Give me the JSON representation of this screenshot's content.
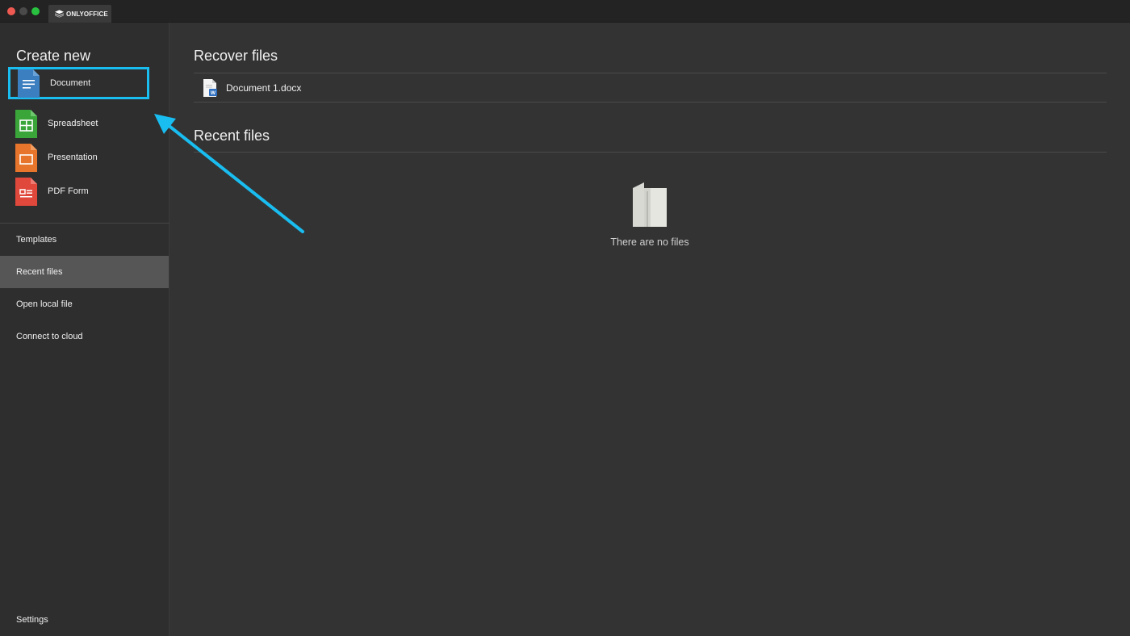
{
  "window": {
    "tab_title": "ONLYOFFICE",
    "tab_icon": "onlyoffice-logo-icon"
  },
  "sidebar": {
    "create_title": "Create new",
    "create_items": [
      {
        "label": "Document",
        "icon": "document-icon",
        "color": "#3c7fc0"
      },
      {
        "label": "Spreadsheet",
        "icon": "spreadsheet-icon",
        "color": "#3aa63a"
      },
      {
        "label": "Presentation",
        "icon": "presentation-icon",
        "color": "#e7752b"
      },
      {
        "label": "PDF Form",
        "icon": "pdf-form-icon",
        "color": "#e0483c"
      }
    ],
    "nav_items": [
      {
        "label": "Templates",
        "active": false
      },
      {
        "label": "Recent files",
        "active": true
      },
      {
        "label": "Open local file",
        "active": false
      },
      {
        "label": "Connect to cloud",
        "active": false
      }
    ],
    "settings_label": "Settings"
  },
  "main": {
    "recover_title": "Recover files",
    "recover_files": [
      {
        "name": "Document 1.docx",
        "icon": "docx-file-icon"
      }
    ],
    "recent_title": "Recent files",
    "empty_message": "There are no files",
    "empty_icon": "empty-folder-icon"
  },
  "annotation": {
    "highlight_color": "#19bdf0",
    "target": "Document"
  }
}
